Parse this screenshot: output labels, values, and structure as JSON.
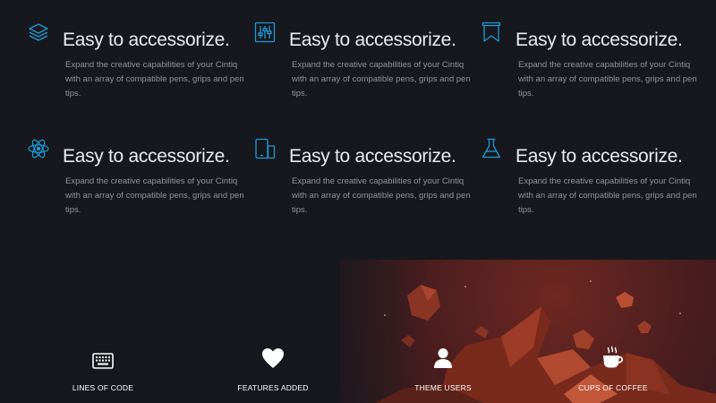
{
  "features": {
    "items": [
      {
        "icon": "layers-icon",
        "title": "Easy to accessorize.",
        "description": "Expand the creative capabilities of your Cintiq with an array of compatible pens, grips and pen tips."
      },
      {
        "icon": "sliders-icon",
        "title": "Easy to accessorize.",
        "description": "Expand the creative capabilities of your Cintiq with an array of compatible pens, grips and pen tips."
      },
      {
        "icon": "bookmark-icon",
        "title": "Easy to accessorize.",
        "description": "Expand the creative capabilities of your Cintiq with an array of compatible pens, grips and pen tips."
      },
      {
        "icon": "atom-icon",
        "title": "Easy to accessorize.",
        "description": "Expand the creative capabilities of your Cintiq with an array of compatible pens, grips and pen tips."
      },
      {
        "icon": "devices-icon",
        "title": "Easy to accessorize.",
        "description": "Expand the creative capabilities of your Cintiq with an array of compatible pens, grips and pen tips."
      },
      {
        "icon": "flask-icon",
        "title": "Easy to accessorize.",
        "description": "Expand the creative capabilities of your Cintiq with an array of compatible pens, grips and pen tips."
      }
    ],
    "icon_color": "#1e9bd7"
  },
  "stats": {
    "items": [
      {
        "icon": "keyboard-icon",
        "label": "LINES OF CODE"
      },
      {
        "icon": "heart-icon",
        "label": "FEATURES ADDED"
      },
      {
        "icon": "user-icon",
        "label": "THEME USERS"
      },
      {
        "icon": "coffee-cup-icon",
        "label": "CUPS OF COFFEE"
      }
    ],
    "background_colors": [
      "#16181d",
      "#3a1a1a",
      "#7a2a1c"
    ]
  }
}
